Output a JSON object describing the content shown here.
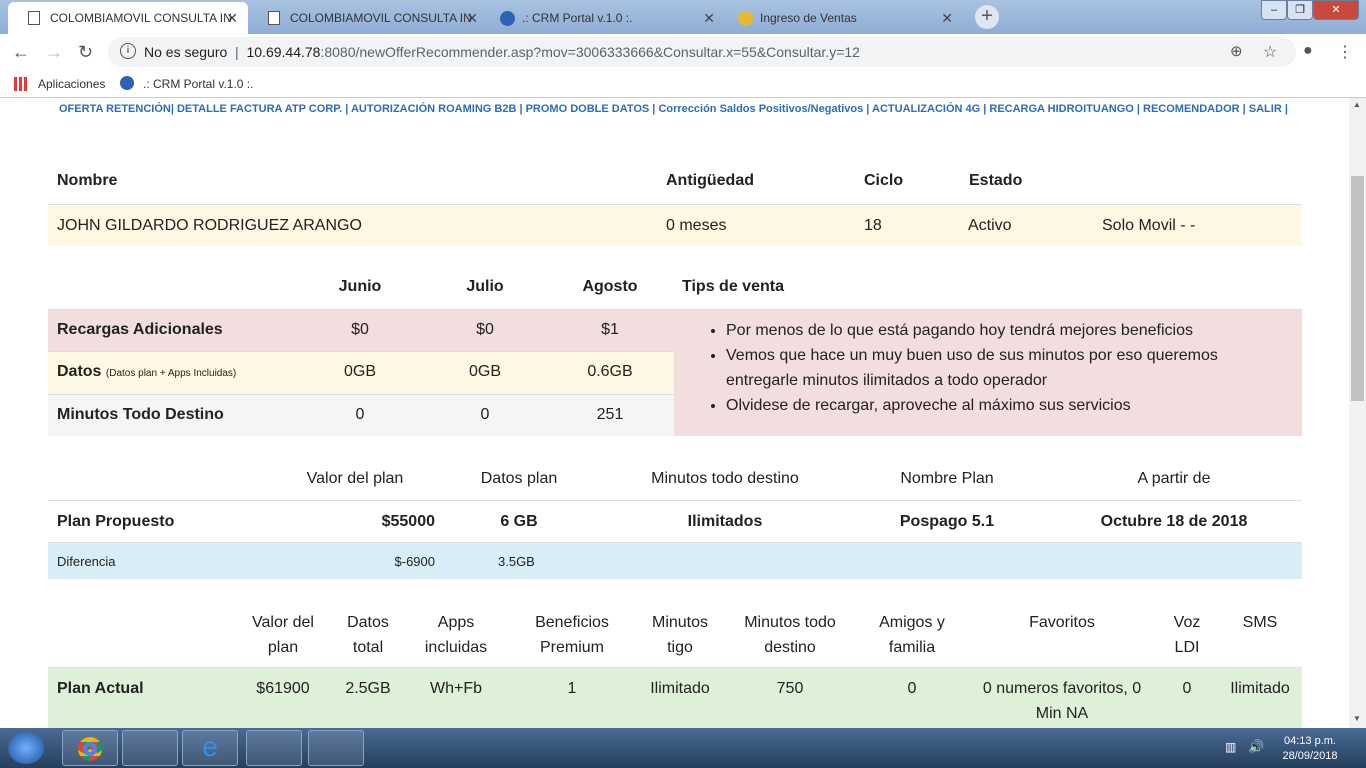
{
  "browser": {
    "tabs": [
      {
        "title": "COLOMBIAMOVIL CONSULTA IN",
        "active": true
      },
      {
        "title": "COLOMBIAMOVIL CONSULTA IN",
        "active": false
      },
      {
        "title": ".: CRM Portal v.1.0 :.",
        "active": false
      },
      {
        "title": "Ingreso de Ventas",
        "active": false
      }
    ],
    "security": "No es seguro",
    "url_host": "10.69.44.78",
    "url_rest": ":8080/newOfferRecommender.asp?mov=3006333666&Consultar.x=55&Consultar.y=12",
    "bookmarks": [
      "Aplicaciones",
      ".: CRM Portal v.1.0 :."
    ]
  },
  "menu": [
    "OFERTA RETENCIÓN|",
    "DETALLE FACTURA ATP CORP. |",
    "AUTORIZACIÓN ROAMING B2B |",
    "PROMO DOBLE DATOS |",
    "Corrección Saldos Positivos/Negativos |",
    "ACTUALIZACIÓN 4G |",
    "RECARGA HIDROITUANGO |",
    "RECOMENDADOR |",
    "SALIR |"
  ],
  "cliente": {
    "headers": [
      "Nombre",
      "Antigüedad",
      "Ciclo",
      "Estado"
    ],
    "nombre": "JOHN GILDARDO RODRIGUEZ ARANGO",
    "antiguedad": "0 meses",
    "ciclo": "18",
    "estado": "Activo",
    "tipo": "Solo Movil - -"
  },
  "consumo": {
    "months": [
      "Junio",
      "Julio",
      "Agosto"
    ],
    "tips_title": "Tips de venta",
    "rows": [
      {
        "label": "Recargas Adicionales",
        "sub": "",
        "values": [
          "$0",
          "$0",
          "$1"
        ]
      },
      {
        "label": "Datos",
        "sub": "(Datos plan + Apps Incluidas)",
        "values": [
          "0GB",
          "0GB",
          "0.6GB"
        ]
      },
      {
        "label": "Minutos Todo Destino",
        "sub": "",
        "values": [
          "0",
          "0",
          "251"
        ]
      }
    ],
    "tips": [
      "Por menos de lo que está pagando hoy tendrá mejores beneficios",
      "Vemos que hace un muy buen uso de sus minutos por eso queremos entregarle minutos ilimitados a todo operador",
      "Olvidese de recargar, aproveche al máximo sus servicios"
    ]
  },
  "propuesto": {
    "headers": [
      "Valor del plan",
      "Datos plan",
      "Minutos todo destino",
      "Nombre Plan",
      "A partir de"
    ],
    "label": "Plan Propuesto",
    "values": [
      "$55000",
      "6 GB",
      "Ilimitados",
      "Pospago 5.1",
      "Octubre 18 de 2018"
    ],
    "diff_label": "Diferencia",
    "diff": [
      "$-6900",
      "3.5GB"
    ]
  },
  "actual": {
    "headers": [
      "Valor del plan",
      "Datos total",
      "Apps incluidas",
      "Beneficios Premium",
      "Minutos tigo",
      "Minutos todo destino",
      "Amigos y familia",
      "Favoritos",
      "Voz LDI",
      "SMS"
    ],
    "label": "Plan Actual",
    "values": [
      "$61900",
      "2.5GB",
      "Wh+Fb",
      "1",
      "Ilimitado",
      "750",
      "0",
      "0 numeros favoritos, 0 Min NA",
      "0",
      "Ilimitado"
    ]
  },
  "taskbar": {
    "time": "04:13 p.m.",
    "date": "28/09/2018"
  }
}
